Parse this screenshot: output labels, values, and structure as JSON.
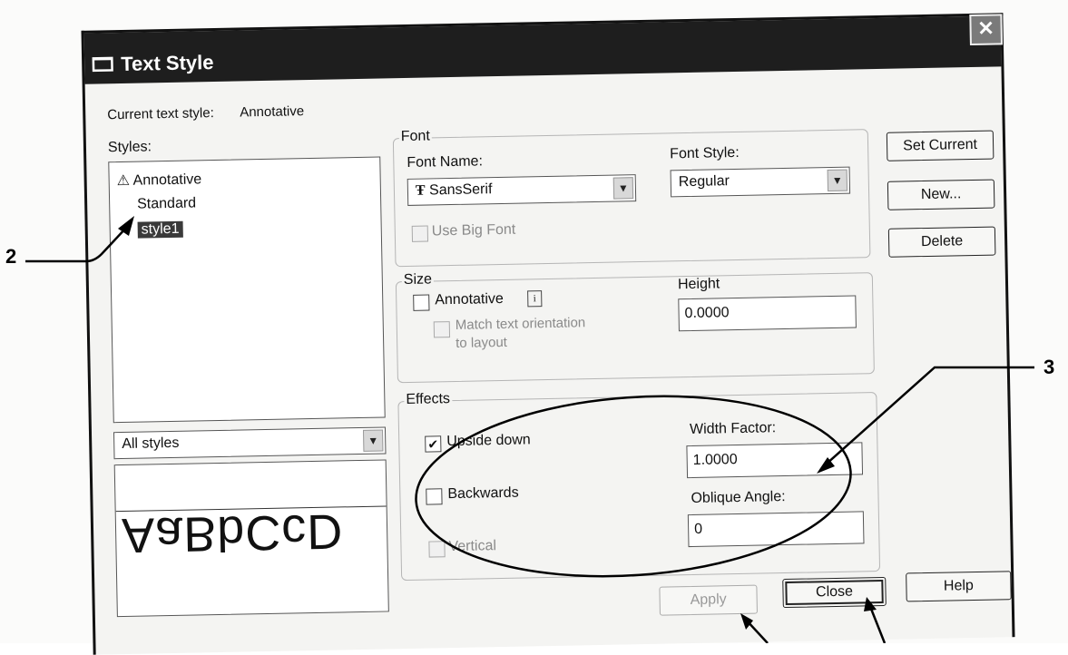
{
  "window": {
    "title": "Text Style",
    "close_glyph": "✕"
  },
  "current_style": {
    "label": "Current text style:",
    "value": "Annotative"
  },
  "styles": {
    "label": "Styles:",
    "items": [
      {
        "label": "Annotative",
        "icon": "annotative-icon"
      },
      {
        "label": "Standard"
      },
      {
        "label": "style1",
        "selected": true
      }
    ],
    "filter_value": "All styles"
  },
  "preview": {
    "text": "AaBbCcD",
    "upside_down": true
  },
  "font": {
    "group_label": "Font",
    "font_name_label": "Font Name:",
    "font_name_value": "SansSerif",
    "font_style_label": "Font Style:",
    "font_style_value": "Regular",
    "use_big_font_label": "Use Big Font"
  },
  "size": {
    "group_label": "Size",
    "annotative_label": "Annotative",
    "info_glyph": "i",
    "match_label_line1": "Match text orientation",
    "match_label_line2": "to layout",
    "height_label": "Height",
    "height_value": "0.0000"
  },
  "effects": {
    "group_label": "Effects",
    "upside_down_label": "Upside down",
    "upside_down_checked": true,
    "backwards_label": "Backwards",
    "vertical_label": "Vertical",
    "width_factor_label": "Width Factor:",
    "width_factor_value": "1.0000",
    "oblique_angle_label": "Oblique Angle:",
    "oblique_angle_value": "0"
  },
  "buttons": {
    "set_current": "Set Current",
    "new": "New...",
    "delete": "Delete",
    "apply": "Apply",
    "close": "Close",
    "help": "Help"
  },
  "callouts": {
    "two": "2",
    "three": "3"
  },
  "colors": {
    "titlebar": "#1e1e1e",
    "selection": "#3a3a3a",
    "dialog_bg": "#f4f4f2"
  }
}
